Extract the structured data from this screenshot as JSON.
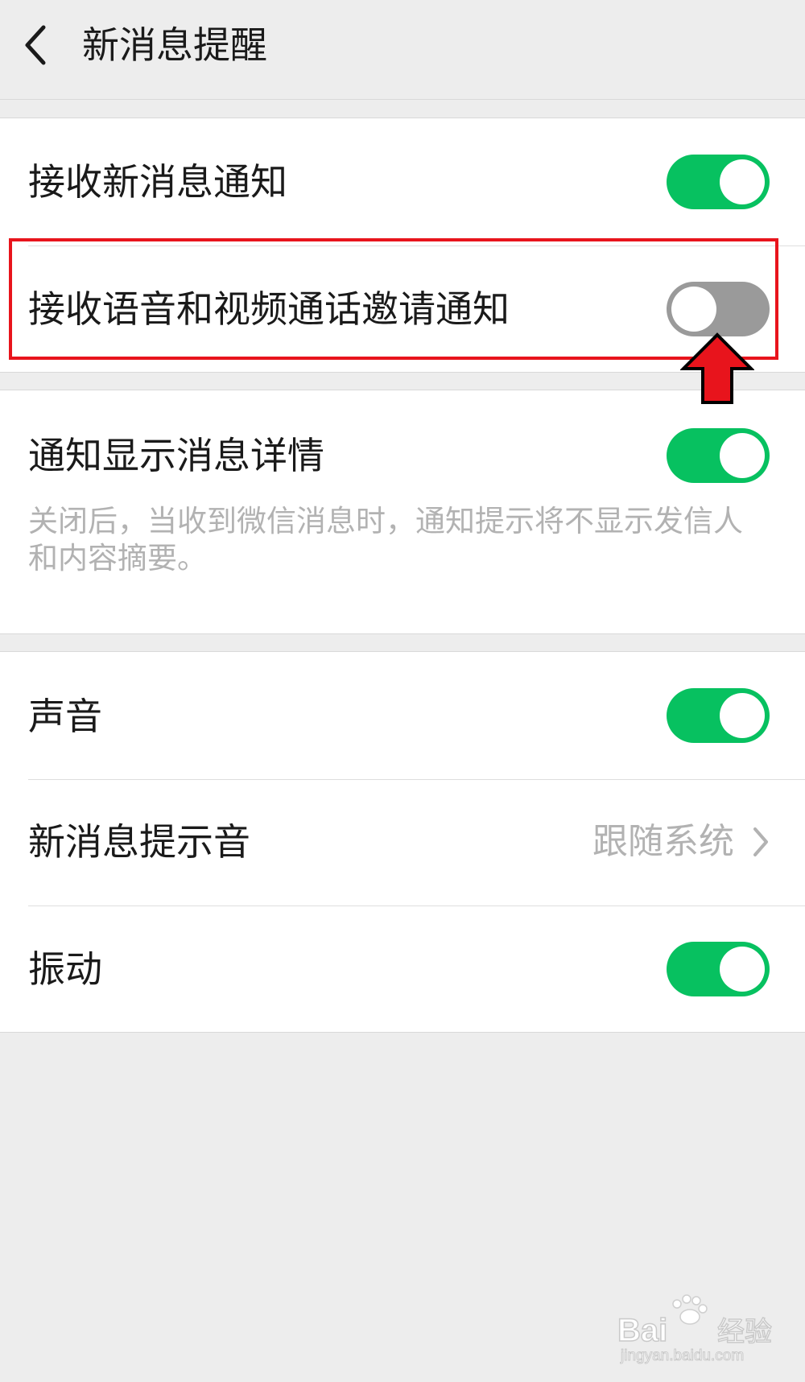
{
  "header": {
    "title": "新消息提醒",
    "back_icon": "chevron-left-icon"
  },
  "settings": {
    "receive_new_message": {
      "label": "接收新消息通知",
      "enabled": true
    },
    "receive_call_invite": {
      "label": "接收语音和视频通话邀请通知",
      "enabled": false
    },
    "show_details": {
      "label": "通知显示消息详情",
      "enabled": true,
      "description": "关闭后，当收到微信消息时，通知提示将不显示发信人和内容摘要。"
    },
    "sound": {
      "label": "声音",
      "enabled": true
    },
    "ringtone": {
      "label": "新消息提示音",
      "value": "跟随系统"
    },
    "vibrate": {
      "label": "振动",
      "enabled": true
    }
  },
  "annotation": {
    "highlight_color": "#e8141c",
    "arrow_icon": "red-up-arrow-icon"
  },
  "colors": {
    "toggle_on": "#07c160",
    "toggle_off": "#9a9a9a",
    "background": "#ededed"
  },
  "watermark": {
    "brand": "Baidu经验",
    "url": "jingyan.baidu.com"
  }
}
